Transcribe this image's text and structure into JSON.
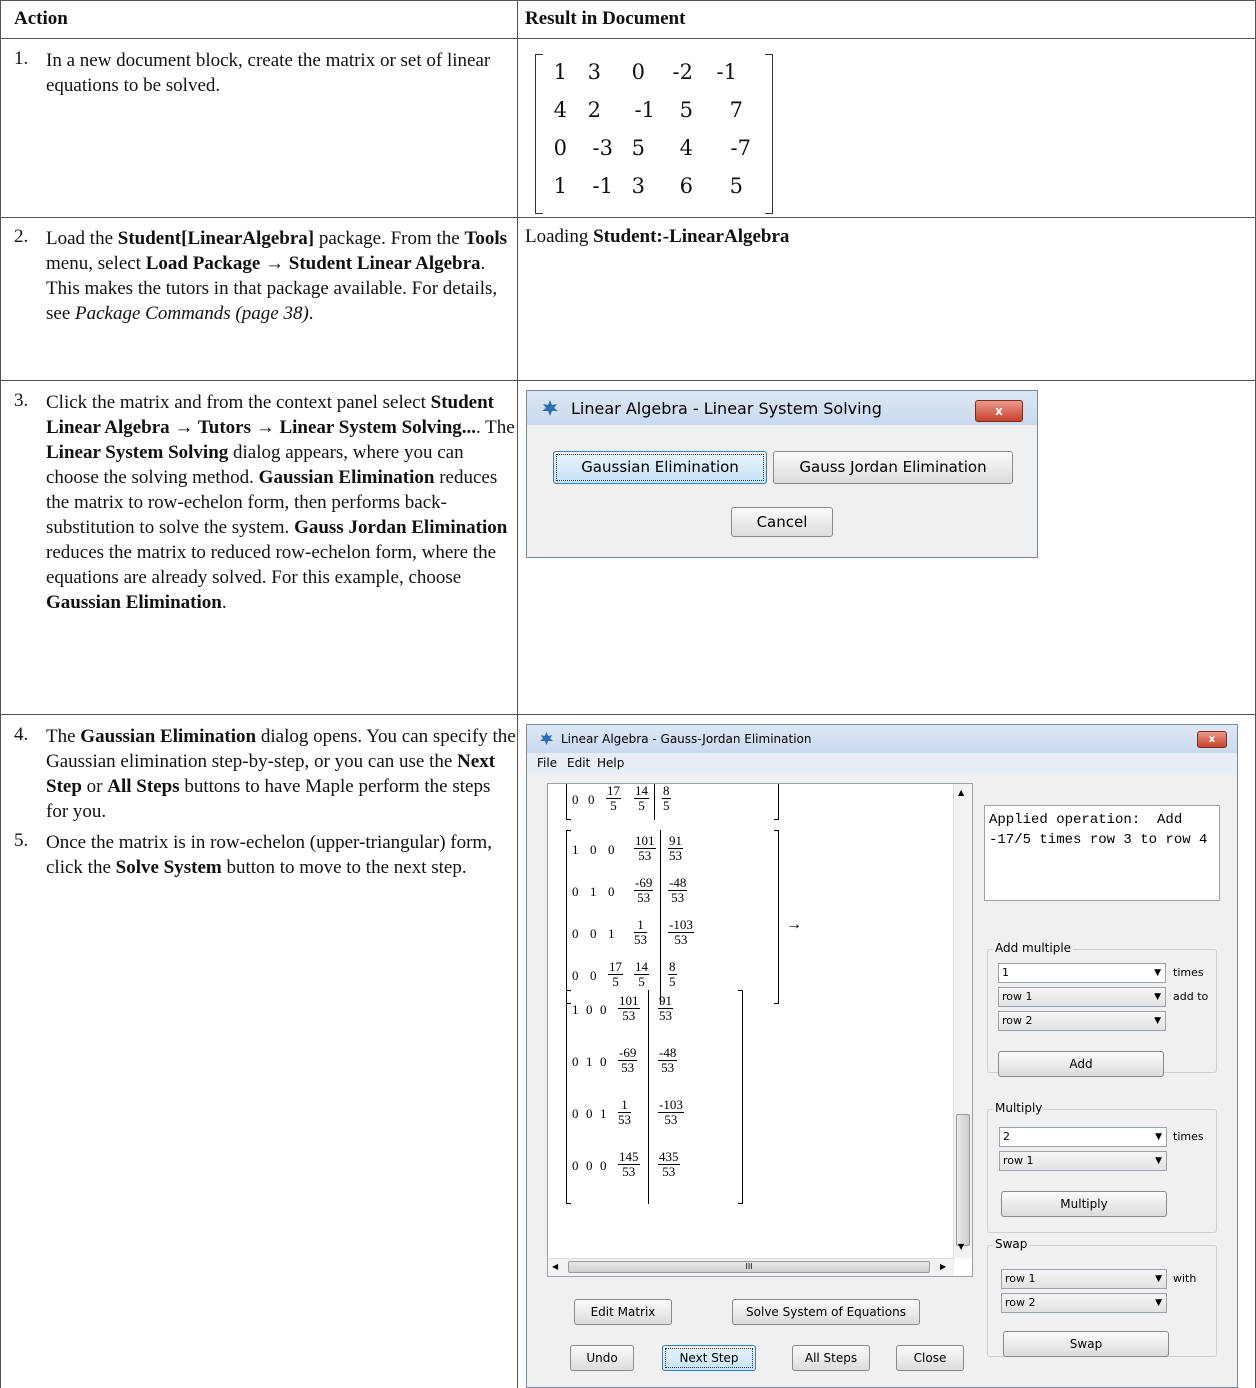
{
  "headers": {
    "action": "Action",
    "result": "Result in Document"
  },
  "rows": [
    {
      "num": "1.",
      "text": "In a new document block, create the matrix or set of linear equations to be solved."
    },
    {
      "num": "2.",
      "text_parts": [
        "Load the ",
        "Student[LinearAlgebra]",
        " package. From the ",
        "Tools",
        " menu, select ",
        "Load Package → Student Linear Algebra",
        ". This makes the tutors in that package available. For details, see ",
        "Package Commands (page 38)",
        "."
      ],
      "result_prefix": "Loading ",
      "result_bold": "Student:-LinearAlgebra"
    },
    {
      "num": "3.",
      "text_parts": [
        "Click the matrix and from the context panel select ",
        "Student Linear Algebra → Tutors → Linear System Solving...",
        ". The ",
        "Linear System Solving",
        " dialog appears, where you can choose the solving method. ",
        "Gaussian Elimination",
        " reduces the matrix to row-echelon form, then performs back-substitution to solve the system. ",
        "Gauss Jordan Elimination",
        " reduces the matrix to reduced row-echelon form, where the equations are already solved. For this example, choose ",
        "Gaussian Elimination",
        "."
      ]
    },
    {
      "num": "4.",
      "text_parts": [
        "The ",
        "Gaussian Elimination",
        " dialog opens. You can specify the Gaussian elimination step-by-step, or you can use the ",
        "Next Step",
        " or ",
        "All Steps",
        " buttons to have Maple perform the steps for you."
      ]
    },
    {
      "num": "5.",
      "text_parts": [
        "Once the matrix is in row-echelon (upper-triangular) form, click the ",
        "Solve System",
        " button to move to the next step."
      ]
    }
  ],
  "matrix": [
    [
      "1",
      "3",
      "0",
      "-2",
      "-1"
    ],
    [
      "4",
      "2",
      "-1",
      "5",
      "7"
    ],
    [
      "0",
      "-3",
      "5",
      "4",
      "-7"
    ],
    [
      "1",
      "-1",
      "3",
      "6",
      "5"
    ]
  ],
  "dialog1": {
    "title": "Linear Algebra - Linear System Solving",
    "btn_gauss": "Gaussian Elimination",
    "btn_gj": "Gauss Jordan Elimination",
    "btn_cancel": "Cancel",
    "close": "x"
  },
  "dialog2": {
    "title": "Linear Algebra - Gauss-Jordan Elimination",
    "close": "x",
    "menu": [
      "File",
      "Edit",
      "Help"
    ],
    "applied": "Applied operation:  Add -17/5 times row 3 to row 4",
    "add_multiple": {
      "label": "Add multiple",
      "value": "1",
      "times": "times",
      "row_a": "row 1",
      "add_to": "add to",
      "row_b": "row 2",
      "button": "Add"
    },
    "multiply": {
      "label": "Multiply",
      "value": "2",
      "times": "times",
      "row": "row 1",
      "button": "Multiply"
    },
    "swap": {
      "label": "Swap",
      "row_a": "row 1",
      "with": "with",
      "row_b": "row 2",
      "button": "Swap"
    },
    "buttons": {
      "edit_matrix": "Edit Matrix",
      "solve": "Solve System of Equations",
      "undo": "Undo",
      "next": "Next Step",
      "all": "All Steps",
      "close": "Close"
    },
    "arrow": "→",
    "scroll_marker": "III",
    "m0": [
      [
        "0",
        "0",
        [
          "17",
          "5"
        ],
        [
          "14",
          "5"
        ],
        [
          "8",
          "5"
        ]
      ]
    ],
    "m1": [
      [
        "1",
        "0",
        "0",
        [
          "101",
          "53"
        ],
        [
          "91",
          "53"
        ]
      ],
      [
        "0",
        "1",
        "0",
        [
          "-69",
          "53"
        ],
        [
          "-48",
          "53"
        ]
      ],
      [
        "0",
        "0",
        "1",
        [
          "1",
          "53"
        ],
        [
          "-103",
          "53"
        ]
      ],
      [
        "0",
        "0",
        [
          "17",
          "5"
        ],
        [
          "14",
          "5"
        ],
        [
          "8",
          "5"
        ]
      ]
    ],
    "m2": [
      [
        "1",
        "0",
        "0",
        [
          "101",
          "53"
        ],
        [
          "91",
          "53"
        ]
      ],
      [
        "0",
        "1",
        "0",
        [
          "-69",
          "53"
        ],
        [
          "-48",
          "53"
        ]
      ],
      [
        "0",
        "0",
        "1",
        [
          "1",
          "53"
        ],
        [
          "-103",
          "53"
        ]
      ],
      [
        "0",
        "0",
        "0",
        [
          "145",
          "53"
        ],
        [
          "435",
          "53"
        ]
      ]
    ]
  }
}
